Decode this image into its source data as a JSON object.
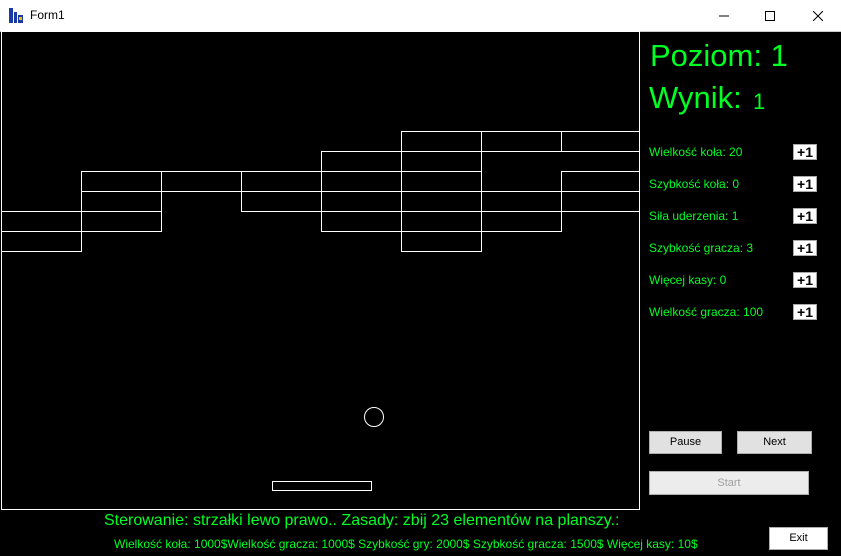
{
  "window": {
    "title": "Form1"
  },
  "hud": {
    "level_label": "Poziom:",
    "level_value": "1",
    "score_label": "Wynik:",
    "score_value": "1"
  },
  "stats": [
    {
      "label": "Wielkość koła: 20",
      "button": "+1"
    },
    {
      "label": "Szybkość koła: 0",
      "button": "+1"
    },
    {
      "label": "Siła uderzenia: 1",
      "button": "+1"
    },
    {
      "label": "Szybkość gracza: 3",
      "button": "+1"
    },
    {
      "label": "Więcej kasy: 0",
      "button": "+1"
    },
    {
      "label": "Wielkość gracza: 100",
      "button": "+1"
    }
  ],
  "buttons": {
    "pause": "Pause",
    "next": "Next",
    "start": "Start",
    "exit": "Exit"
  },
  "footer": {
    "controls": "Sterowanie: strzałki lewo prawo.. Zasady: zbij 23 elementów na planszy.:",
    "prices": "Wielkość koła: 1000$Wielkość gracza: 1000$ Szybkość gry: 2000$ Szybkość gracza: 1500$ Więcej kasy: 10$"
  },
  "colors": {
    "hud_text": "#00ff22",
    "board_bg": "#000000",
    "outline": "#ffffff"
  }
}
